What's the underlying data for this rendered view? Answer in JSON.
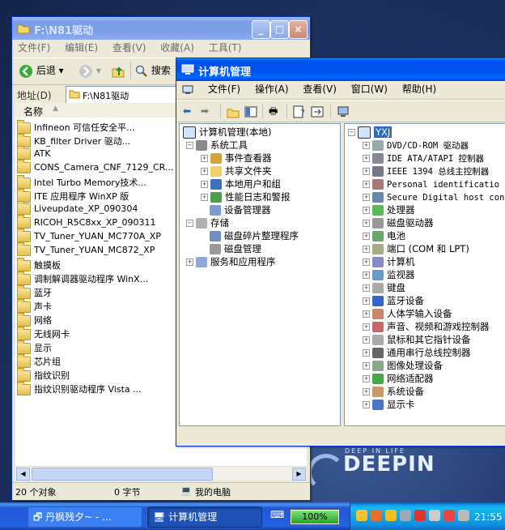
{
  "explorer": {
    "title": "F:\\N81驱动",
    "menu": [
      "文件(F)",
      "编辑(E)",
      "查看(V)",
      "收藏(A)",
      "工具(T)"
    ],
    "toolbar": {
      "back": "后退",
      "search": "搜索"
    },
    "address_label": "地址(D)",
    "address_value": "F:\\N81驱动",
    "column_name": "名称",
    "files": [
      "Infineon 可信任安全平...",
      "KB_filter Driver 驱动...",
      "ATK",
      "CONS_Camera_CNF_7129_CR...",
      "Intel Turbo Memory技术...",
      "ITE 应用程序 WinXP 版",
      "Liveupdate_XP_090304",
      "RICOH_R5C8xx_XP_090311",
      "TV_Tuner_YUAN_MC770A_XP",
      "TV_Tuner_YUAN_MC872_XP",
      "触摸板",
      "调制解调器驱动程序 WinX...",
      "蓝牙",
      "声卡",
      "网络",
      "无线网卡",
      "显示",
      "芯片组",
      "指纹识别",
      "指纹识别驱动程序 Vista ..."
    ],
    "status": {
      "count": "20 个对象",
      "size": "0 字节",
      "location": "我的电脑"
    }
  },
  "compmgmt": {
    "title": "计算机管理",
    "menu": [
      "文件(F)",
      "操作(A)",
      "查看(V)",
      "窗口(W)",
      "帮助(H)"
    ],
    "tree": {
      "root": "计算机管理(本地)",
      "system_tools": "系统工具",
      "event_viewer": "事件查看器",
      "shared_folders": "共享文件夹",
      "local_users": "本地用户和组",
      "perf_logs": "性能日志和警报",
      "device_manager": "设备管理器",
      "storage": "存储",
      "defrag": "磁盘碎片整理程序",
      "disk_mgmt": "磁盘管理",
      "services": "服务和应用程序"
    },
    "device_root": "YXJ",
    "devices": [
      "DVD/CD-ROM 驱动器",
      "IDE ATA/ATAPI 控制器",
      "IEEE 1394 总线主控制器",
      "Personal identificatio",
      "Secure Digital host con",
      "处理器",
      "磁盘驱动器",
      "电池",
      "端口 (COM 和 LPT)",
      "计算机",
      "监视器",
      "键盘",
      "蓝牙设备",
      "人体学输入设备",
      "声音、视频和游戏控制器",
      "鼠标和其它指针设备",
      "通用串行总线控制器",
      "图像处理设备",
      "网络适配器",
      "系统设备",
      "显示卡"
    ]
  },
  "desktop": {
    "brand_sub": "DEEP IN LIFE",
    "brand": "DEEPIN"
  },
  "taskbar": {
    "task1": "丹枫残夕~ - ...",
    "task2": "计算机管理",
    "battery": "100%",
    "battery_level": 1.0,
    "clock": "21:55"
  }
}
